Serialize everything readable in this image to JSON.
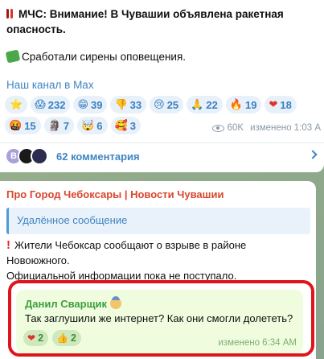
{
  "post": {
    "alert_line1": "МЧС: Внимание! В Чувашии объявлена ракетная",
    "alert_line2": "опасность.",
    "siren_text": "Сработали сирены оповещения.",
    "channel_link": "Наш канал в Max",
    "reactions_row1": [
      {
        "emoji": "⭐",
        "count": ""
      },
      {
        "emoji": "😱",
        "count": "232"
      },
      {
        "emoji": "😁",
        "count": "39"
      },
      {
        "emoji": "👎",
        "count": "33"
      },
      {
        "emoji": "😢",
        "count": "25"
      },
      {
        "emoji": "🙏",
        "count": "22"
      },
      {
        "emoji": "🔥",
        "count": "19"
      },
      {
        "emoji": "❤",
        "count": "18"
      }
    ],
    "reactions_row2": [
      {
        "emoji": "🤬",
        "count": "15"
      },
      {
        "emoji": "🗿",
        "count": "7"
      },
      {
        "emoji": "🤯",
        "count": "6"
      },
      {
        "emoji": "🥰",
        "count": "3"
      }
    ],
    "views": "60K",
    "edited_time": "изменено 1:03 A",
    "comments_avatar_letter": "В",
    "comments_label": "62 комментария"
  },
  "reply_post": {
    "author": "Про Город Чебоксары | Новости Чувашии",
    "deleted_quote": "Удалённое сообщение",
    "body_line1": "Жители Чебоксар сообщают о взрыве в районе",
    "body_line2": "Новоюжного.",
    "body_line3": "Официальной информации пока не поступало."
  },
  "comment": {
    "author": "Данил Сварщик",
    "text": "Так заглушили же интернет? Как они смогли долететь?",
    "reactions": [
      {
        "emoji": "❤",
        "count": "2"
      },
      {
        "emoji": "👍",
        "count": "2"
      }
    ],
    "edited_time": "изменено 6:34 AM"
  },
  "colors": {
    "link": "#3f84c2",
    "author_red": "#d9472f",
    "comment_author_green": "#3d9e3d",
    "highlight": "#e0141b"
  }
}
